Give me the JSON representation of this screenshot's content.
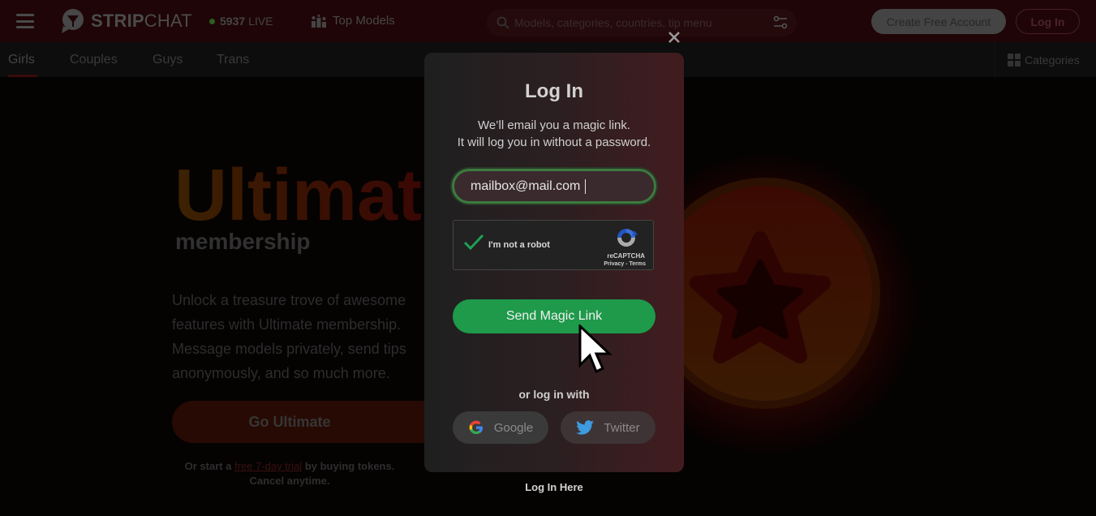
{
  "header": {
    "logo_bold": "STRIP",
    "logo_thin": "CHAT",
    "live_count": "5937",
    "live_label": "LIVE",
    "top_models": "Top Models",
    "search_placeholder": "Models, categories, countries, tip menu",
    "create_account": "Create Free Account",
    "login": "Log In"
  },
  "subnav": {
    "tabs": [
      {
        "label": "Girls",
        "active": true
      },
      {
        "label": "Couples"
      },
      {
        "label": "Guys"
      },
      {
        "label": "Trans"
      }
    ],
    "categories": "Categories"
  },
  "hero": {
    "title": "Ultimate",
    "subtitle": "membership",
    "description": "Unlock a treasure trove of awesome features with Ultimate membership. Message models privately, send tips anonymously, and so much more.",
    "cta": "Go Ultimate",
    "trial_prefix": "Or start a",
    "trial_link": "free 7-day trial",
    "trial_suffix": "by buying tokens.",
    "trial_cancel": "Cancel anytime."
  },
  "modal": {
    "title": "Log In",
    "desc_line1": "We’ll email you a magic link.",
    "desc_line2": "It will log you in without a password.",
    "email_value": "mailbox@mail.com",
    "captcha_label": "I'm not a robot",
    "captcha_brand": "reCAPTCHA",
    "captcha_links": "Privacy - Terms",
    "send_button": "Send Magic Link",
    "or_text": "or log in with",
    "google": "Google",
    "twitter": "Twitter",
    "login_here": "Log In Here"
  },
  "colors": {
    "accent_green": "#1e9a4a",
    "header_bg": "#1f0507"
  }
}
